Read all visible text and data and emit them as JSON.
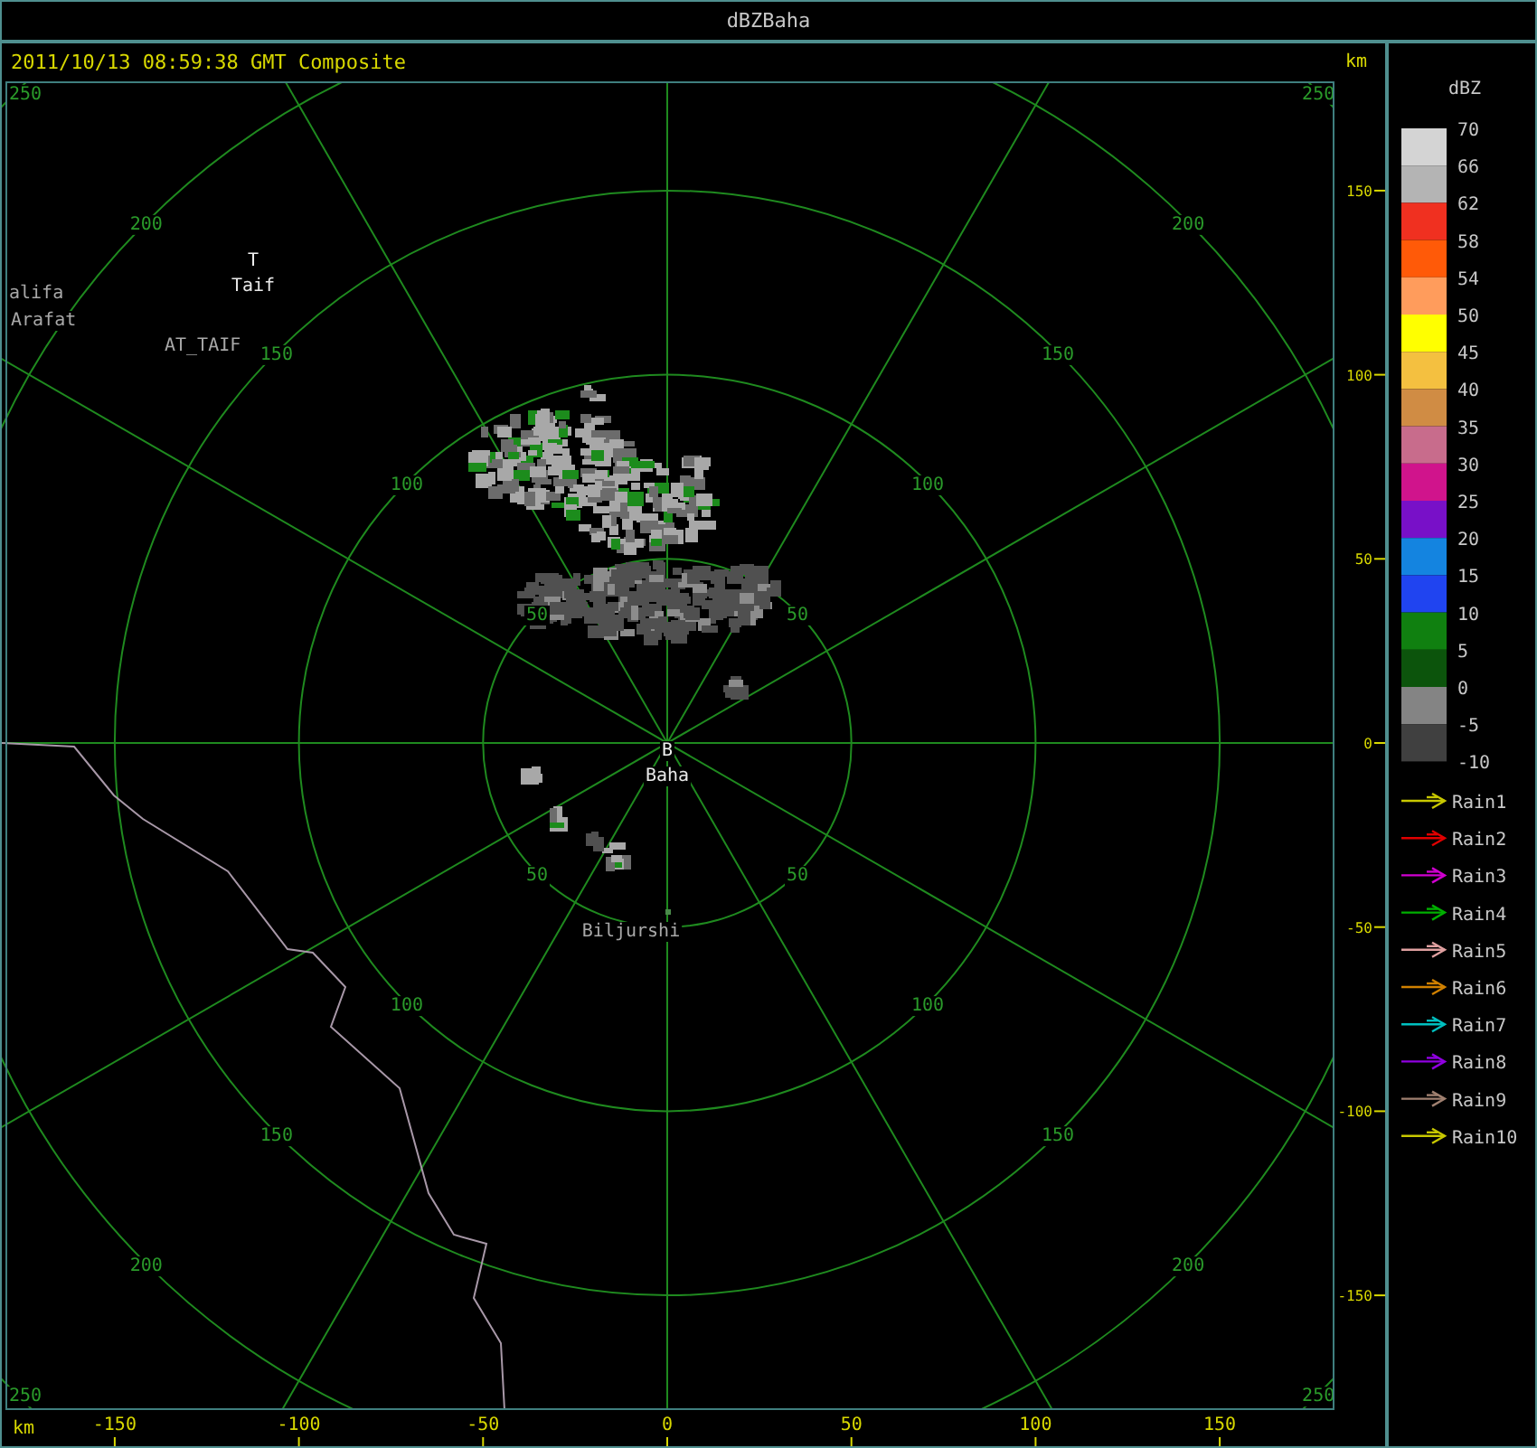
{
  "window": {
    "title": "dBZBaha"
  },
  "header": {
    "timestamp": "2011/10/13 08:59:38 GMT Composite",
    "unit": "km"
  },
  "map": {
    "range_rings": [
      {
        "labels": [
          "50",
          "50",
          "50",
          "50"
        ]
      },
      {
        "labels": [
          "100",
          "100",
          "100",
          "100"
        ]
      },
      {
        "labels": [
          "150",
          "150",
          "150",
          "150"
        ]
      },
      {
        "labels": [
          "200",
          "200",
          "200",
          "200"
        ]
      },
      {
        "labels": [
          "250",
          "250",
          "250",
          "250"
        ]
      }
    ],
    "places": [
      {
        "kind": "name",
        "label": "alifa"
      },
      {
        "kind": "site",
        "marker": "T",
        "label": "Taif"
      },
      {
        "kind": "name",
        "label": "Arafat"
      },
      {
        "kind": "name",
        "label": "AT_TAIF"
      },
      {
        "kind": "site",
        "marker": "B",
        "label": "Baha"
      },
      {
        "kind": "town",
        "label": "Biljurshi"
      }
    ]
  },
  "y_axis": {
    "ticks": [
      "150",
      "100",
      "50",
      "0",
      "-50",
      "-100",
      "-150"
    ]
  },
  "x_axis": {
    "unit": "km",
    "ticks": [
      "-150",
      "-100",
      "-50",
      "0",
      "50",
      "100",
      "150"
    ]
  },
  "legend": {
    "title": "dBZ",
    "levels": [
      "70",
      "66",
      "62",
      "58",
      "54",
      "50",
      "45",
      "40",
      "35",
      "30",
      "25",
      "20",
      "15",
      "10",
      "5",
      "0",
      "-5",
      "-10"
    ],
    "bins": [
      {
        "color": "#d4d4d4"
      },
      {
        "color": "#b4b4b4"
      },
      {
        "color": "#f03020"
      },
      {
        "color": "#ff5a08"
      },
      {
        "color": "#ff9c5c"
      },
      {
        "color": "#ffff00"
      },
      {
        "color": "#f4c040"
      },
      {
        "color": "#d08c44"
      },
      {
        "color": "#c86c8c"
      },
      {
        "color": "#d0148c"
      },
      {
        "color": "#7810c8"
      },
      {
        "color": "#1484e0"
      },
      {
        "color": "#2044f0"
      },
      {
        "color": "#108010"
      },
      {
        "color": "#0c540c"
      },
      {
        "color": "#848484"
      },
      {
        "color": "#404040"
      }
    ],
    "series": [
      {
        "label": "Rain1",
        "color": "#c8c800"
      },
      {
        "label": "Rain2",
        "color": "#e00000"
      },
      {
        "label": "Rain3",
        "color": "#d000d0"
      },
      {
        "label": "Rain4",
        "color": "#00b000"
      },
      {
        "label": "Rain5",
        "color": "#e0a0a0"
      },
      {
        "label": "Rain6",
        "color": "#d08000"
      },
      {
        "label": "Rain7",
        "color": "#00c0c0"
      },
      {
        "label": "Rain8",
        "color": "#9000e0"
      },
      {
        "label": "Rain9",
        "color": "#a08070"
      },
      {
        "label": "Rain10",
        "color": "#c8c800"
      }
    ]
  }
}
